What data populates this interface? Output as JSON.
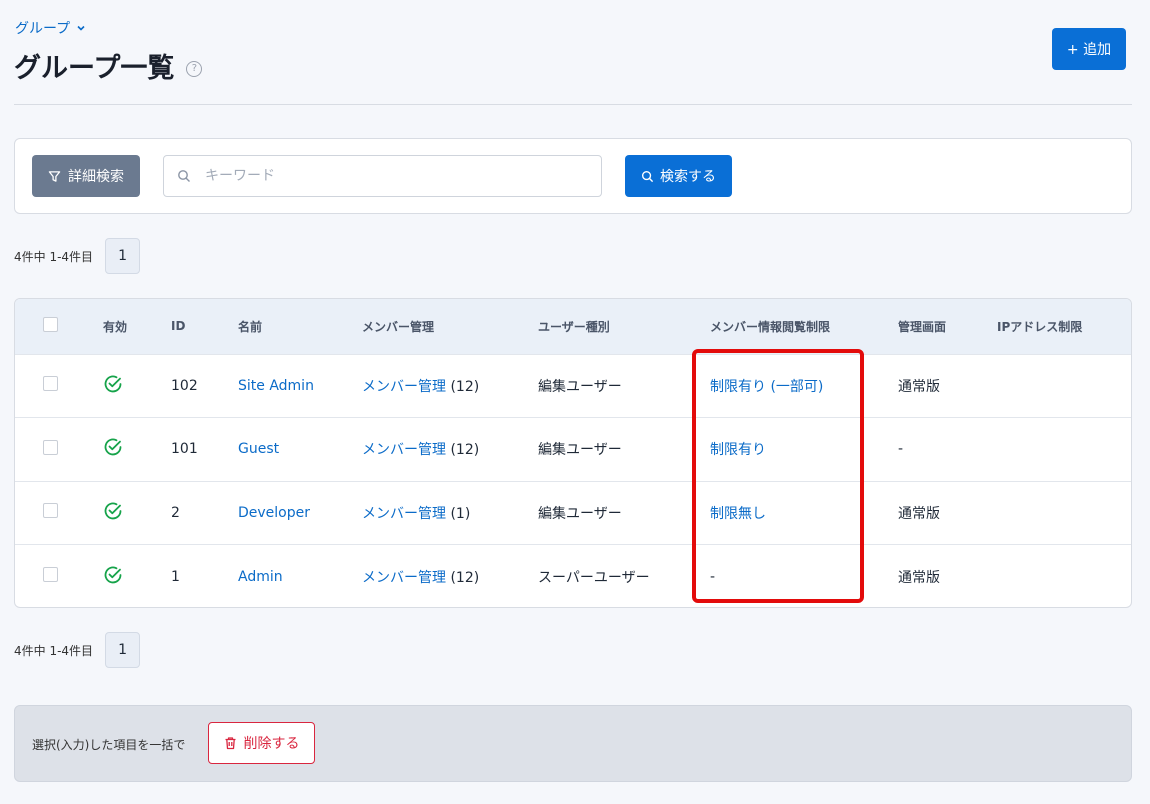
{
  "breadcrumb": {
    "label": "グループ"
  },
  "page": {
    "title": "グループ一覧",
    "add_label": "+ 追加"
  },
  "search": {
    "detail_label": "詳細検索",
    "keyword_placeholder": "キーワード",
    "submit_label": "検索する"
  },
  "pagination": {
    "summary": "4件中 1-4件目",
    "current_page": "1"
  },
  "table": {
    "headers": [
      "有効",
      "ID",
      "名前",
      "メンバー管理",
      "ユーザー種別",
      "メンバー情報閲覧制限",
      "管理画面",
      "IPアドレス制限"
    ],
    "rows": [
      {
        "id": "102",
        "name": "Site Admin",
        "member_link": "メンバー管理",
        "member_count": "(12)",
        "user_type": "編集ユーザー",
        "restriction": "制限有り (一部可)",
        "admin_screen": "通常版",
        "ip": ""
      },
      {
        "id": "101",
        "name": "Guest",
        "member_link": "メンバー管理",
        "member_count": "(12)",
        "user_type": "編集ユーザー",
        "restriction": "制限有り",
        "admin_screen": "-",
        "ip": ""
      },
      {
        "id": "2",
        "name": "Developer",
        "member_link": "メンバー管理",
        "member_count": "(1)",
        "user_type": "編集ユーザー",
        "restriction": "制限無し",
        "admin_screen": "通常版",
        "ip": ""
      },
      {
        "id": "1",
        "name": "Admin",
        "member_link": "メンバー管理",
        "member_count": "(12)",
        "user_type": "スーパーユーザー",
        "restriction": "-",
        "admin_screen": "通常版",
        "ip": ""
      }
    ]
  },
  "bulk": {
    "label": "選択(入力)した項目を一括で",
    "delete_label": "削除する"
  },
  "colors": {
    "accent": "#0a6fd6",
    "link": "#0b6bc8",
    "success": "#16a34a",
    "danger": "#d9263f",
    "highlight": "#e30b0b"
  }
}
